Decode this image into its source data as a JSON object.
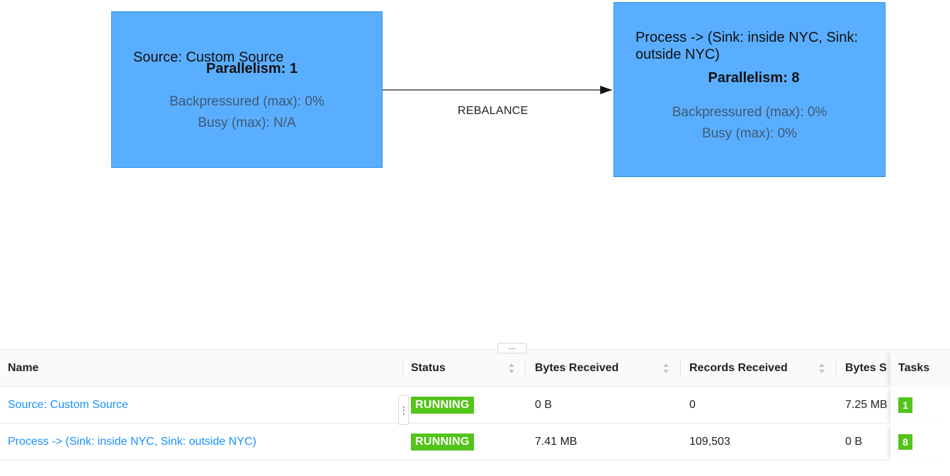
{
  "graph": {
    "source_node": {
      "title": "Source: Custom Source",
      "parallelism": "Parallelism: 1",
      "backpressured": "Backpressured (max): 0%",
      "busy": "Busy (max): N/A"
    },
    "process_node": {
      "title": "Process -> (Sink: inside NYC, Sink: outside NYC)",
      "parallelism": "Parallelism: 8",
      "backpressured": "Backpressured (max): 0%",
      "busy": "Busy (max): 0%"
    },
    "edge_label": "REBALANCE",
    "node_color": "#5aaeff"
  },
  "panel_handle": "...",
  "table": {
    "columns": {
      "name": "Name",
      "status": "Status",
      "bytes_received": "Bytes Received",
      "records_received": "Records Received",
      "bytes_sent": "Bytes S",
      "tasks": "Tasks"
    },
    "rows": [
      {
        "name": "Source: Custom Source",
        "status": "RUNNING",
        "bytes_received": "0 B",
        "records_received": "0",
        "bytes_sent": "7.25 MB",
        "tasks": "1"
      },
      {
        "name": "Process -> (Sink: inside NYC, Sink: outside NYC)",
        "status": "RUNNING",
        "bytes_received": "7.41 MB",
        "records_received": "109,503",
        "bytes_sent": "0 B",
        "tasks": "8"
      }
    ],
    "row_menu_handle": "⋮",
    "colors": {
      "link": "#1890ff",
      "running": "#52c41a"
    }
  }
}
